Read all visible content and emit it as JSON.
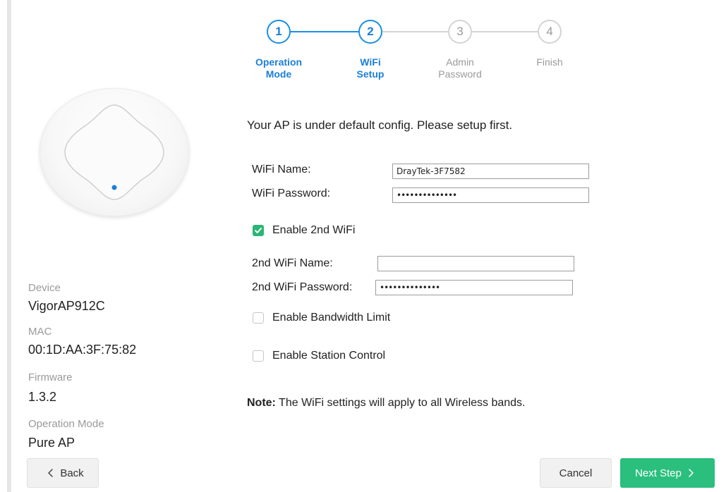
{
  "stepper": {
    "steps": [
      {
        "number": "1",
        "label_line1": "Operation",
        "label_line2": "Mode",
        "state": "done"
      },
      {
        "number": "2",
        "label_line1": "WiFi",
        "label_line2": "Setup",
        "state": "current"
      },
      {
        "number": "3",
        "label_line1": "Admin",
        "label_line2": "Password",
        "state": "pending"
      },
      {
        "number": "4",
        "label_line1": "Finish",
        "label_line2": "",
        "state": "pending"
      }
    ]
  },
  "device_info": {
    "device_label": "Device",
    "device_value": "VigorAP912C",
    "mac_label": "MAC",
    "mac_value": "00:1D:AA:3F:75:82",
    "firmware_label": "Firmware",
    "firmware_value": "1.3.2",
    "mode_label": "Operation Mode",
    "mode_value": "Pure AP"
  },
  "form": {
    "intro": "Your AP is under default config. Please setup first.",
    "wifi_name_label": "WiFi Name:",
    "wifi_name_value": "DrayTek-3F7582",
    "wifi_password_label": "WiFi Password:",
    "wifi_password_value": "••••••••••••••",
    "enable_2nd_wifi_label": "Enable 2nd WiFi",
    "enable_2nd_wifi_checked": true,
    "second_wifi_name_label": "2nd WiFi Name:",
    "second_wifi_name_value": "",
    "second_wifi_password_label": "2nd WiFi Password:",
    "second_wifi_password_value": "••••••••••••••",
    "bandwidth_limit_label": "Enable Bandwidth Limit",
    "bandwidth_limit_checked": false,
    "station_control_label": "Enable Station Control",
    "station_control_checked": false,
    "note_bold": "Note:",
    "note_text": " The WiFi settings will apply to all Wireless bands."
  },
  "buttons": {
    "back_label": "Back",
    "cancel_label": "Cancel",
    "next_label": "Next Step"
  },
  "colors": {
    "accent_blue": "#1a8fe3",
    "success_green": "#2bbf7e",
    "muted_gray": "#9a9a9a"
  }
}
